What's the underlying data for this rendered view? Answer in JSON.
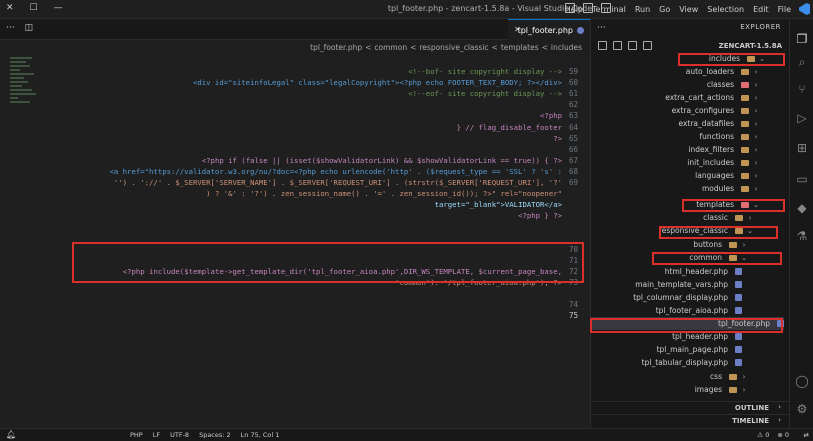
{
  "window": {
    "title": "tpl_footer.php - zencart-1.5.8a - Visual Studio Code",
    "menu": [
      "File",
      "Edit",
      "Selection",
      "View",
      "Go",
      "Run",
      "Terminal",
      "Help"
    ]
  },
  "tab": {
    "label": "tpl_footer.php"
  },
  "breadcrumb": [
    "includes",
    "templates",
    "responsive_classic",
    "common",
    "tpl_footer.php"
  ],
  "explorer": {
    "header": "EXPLORER",
    "project": "ZENCART-1.5.8A",
    "items": [
      {
        "label": "includes",
        "kind": "folder-open",
        "depth": 0
      },
      {
        "label": "auto_loaders",
        "kind": "folder",
        "depth": 1
      },
      {
        "label": "classes",
        "kind": "folder-red",
        "depth": 1
      },
      {
        "label": "extra_cart_actions",
        "kind": "folder",
        "depth": 1
      },
      {
        "label": "extra_configures",
        "kind": "folder",
        "depth": 1
      },
      {
        "label": "extra_datafiles",
        "kind": "folder",
        "depth": 1
      },
      {
        "label": "functions",
        "kind": "folder",
        "depth": 1
      },
      {
        "label": "index_filters",
        "kind": "folder",
        "depth": 1
      },
      {
        "label": "init_includes",
        "kind": "folder",
        "depth": 1
      },
      {
        "label": "languages",
        "kind": "folder",
        "depth": 1
      },
      {
        "label": "modules",
        "kind": "folder",
        "depth": 1
      },
      {
        "label": "templates",
        "kind": "folder-open-red",
        "depth": 1
      },
      {
        "label": "classic",
        "kind": "folder",
        "depth": 2
      },
      {
        "label": "responsive_classic",
        "kind": "folder-open",
        "depth": 2
      },
      {
        "label": "buttons",
        "kind": "folder",
        "depth": 3
      },
      {
        "label": "common",
        "kind": "folder-open",
        "depth": 3
      },
      {
        "label": "html_header.php",
        "kind": "php",
        "depth": 4
      },
      {
        "label": "main_template_vars.php",
        "kind": "php",
        "depth": 4
      },
      {
        "label": "tpl_columnar_display.php",
        "kind": "php",
        "depth": 4
      },
      {
        "label": "tpl_footer_aioa.php",
        "kind": "php",
        "depth": 4
      },
      {
        "label": "tpl_footer.php",
        "kind": "php",
        "depth": 4
      },
      {
        "label": "tpl_header.php",
        "kind": "php",
        "depth": 4
      },
      {
        "label": "tpl_main_page.php",
        "kind": "php",
        "depth": 4
      },
      {
        "label": "tpl_tabular_display.php",
        "kind": "php",
        "depth": 4
      },
      {
        "label": "css",
        "kind": "folder",
        "depth": 3
      },
      {
        "label": "images",
        "kind": "folder",
        "depth": 3
      }
    ],
    "outline": "OUTLINE",
    "timeline": "TIMELINE"
  },
  "code": {
    "line_numbers": [
      "59",
      "60",
      "61",
      "62",
      "63",
      "64",
      "65",
      "66",
      "67",
      "68",
      "69",
      "",
      "",
      "",
      "",
      "",
      "70",
      "71",
      "72",
      "73",
      "",
      "74",
      "75"
    ],
    "lines": [
      "<!--bof- site copyright display -->",
      "<div id=\"siteinfoLegal\" class=\"legalCopyright\"><?php echo FOOTER_TEXT_BODY; ?></div>",
      "<!--eof- site copyright display -->",
      "",
      "<?php",
      "} // flag_disable_footer",
      "?>",
      "",
      "<?php if (false || (isset($showValidatorLink) && $showValidatorLink == true)) { ?>",
      "<a href=\"https://validator.w3.org/nu/?doc=<?php echo urlencode('http' . ($request_type == 'SSL' ? 's' :",
      "'') . '://' . $_SERVER['SERVER_NAME'] . $_SERVER['REQUEST_URI'] . (strstr($_SERVER['REQUEST_URI'], '?'",
      ") ? '&' : '?') . zen_session_name() . '=' . zen_session_id()); ?>\" rel=\"noopener\"",
      "target=\"_blank\">VALIDATOR</a>",
      "<?php } ?>",
      "",
      "",
      "",
      "",
      "<?php include($template->get_template_dir('tpl_footer_aioa.php',DIR_WS_TEMPLATE, $current_page_base,",
      "'common'). '/tpl_footer_aioa.php'); ?>",
      "",
      ""
    ]
  },
  "status": {
    "position": "Ln 75, Col 1",
    "spaces": "Spaces: 2",
    "encoding": "UTF-8",
    "eol": "LF",
    "language": "PHP",
    "errors": "0",
    "warnings": "0"
  },
  "colors": {
    "highlight": "#d9302c",
    "accent": "#0078d4"
  }
}
